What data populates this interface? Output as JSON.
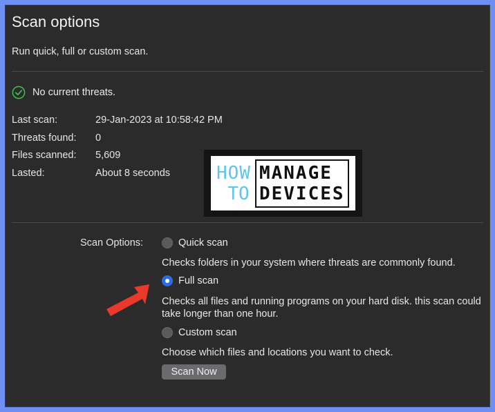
{
  "header": {
    "title": "Scan options",
    "subtitle": "Run quick, full or custom scan."
  },
  "status": {
    "text": "No current threats.",
    "icon": "check-circle-icon",
    "color": "#3dbb4f"
  },
  "info": [
    {
      "label": "Last scan:",
      "value": "29-Jan-2023 at 10:58:42 PM"
    },
    {
      "label": "Threats found:",
      "value": "0"
    },
    {
      "label": "Files scanned:",
      "value": "5,609"
    },
    {
      "label": "Lasted:",
      "value": "About 8 seconds"
    }
  ],
  "logo": {
    "how": "HOW",
    "to": "TO",
    "manage": "MANAGE",
    "devices": "DEVICES"
  },
  "scan_options": {
    "label": "Scan Options:",
    "selected": "full",
    "options": [
      {
        "id": "quick",
        "label": "Quick scan",
        "description": "Checks folders in your system where threats are commonly found."
      },
      {
        "id": "full",
        "label": "Full scan",
        "description": "Checks all files and running programs on your hard disk. this scan could take longer than one hour."
      },
      {
        "id": "custom",
        "label": "Custom scan",
        "description": "Choose which files and locations you want to check."
      }
    ],
    "button_label": "Scan Now",
    "accent": "#2d6cdf"
  },
  "annotation": {
    "arrow_color": "#e8392a"
  }
}
